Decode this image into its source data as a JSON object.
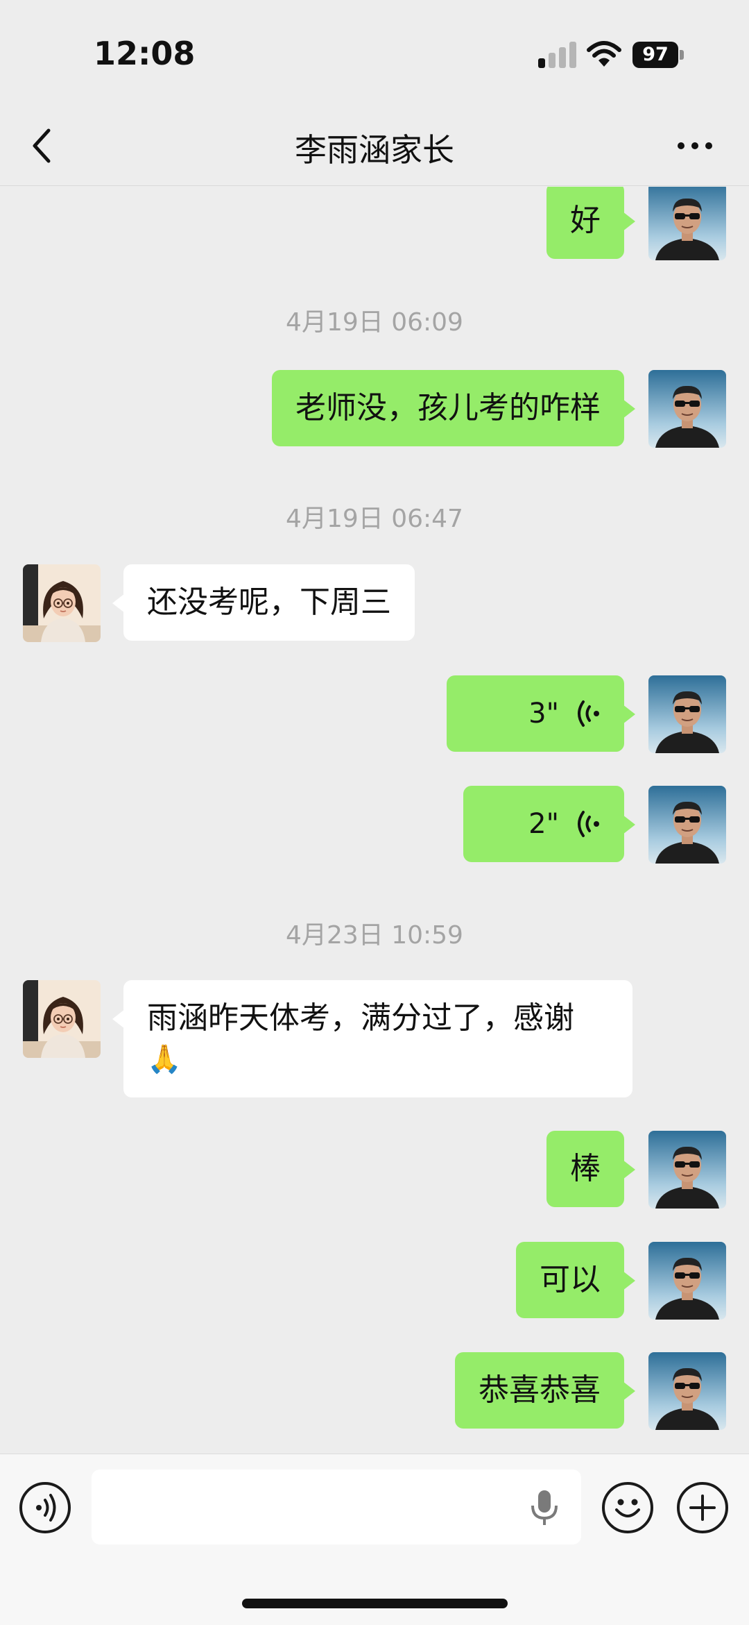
{
  "status_bar": {
    "time": "12:08",
    "battery": "97"
  },
  "nav": {
    "title": "李雨涵家长"
  },
  "messages": [
    {
      "side": "out",
      "text": "好"
    },
    {
      "timestamp": "4月19日 06:09"
    },
    {
      "side": "out",
      "text": "老师没，孩儿考的咋样"
    },
    {
      "timestamp": "4月19日 06:47"
    },
    {
      "side": "in",
      "text": "还没考呢，下周三"
    },
    {
      "side": "out",
      "voice": "3\""
    },
    {
      "side": "out",
      "voice": "2\""
    },
    {
      "timestamp": "4月23日 10:59"
    },
    {
      "side": "in",
      "text": "雨涵昨天体考，满分过了，感谢",
      "emoji": "🙏"
    },
    {
      "side": "out",
      "text": "棒"
    },
    {
      "side": "out",
      "text": "可以"
    },
    {
      "side": "out",
      "text": "恭喜恭喜"
    }
  ],
  "input_bar": {
    "text": ""
  },
  "colors": {
    "bubble_out": "#95EC69",
    "bubble_in": "#FFFFFF",
    "background": "#EDEDED"
  },
  "icons": [
    "back-icon",
    "more-icon",
    "voice-wave-icon",
    "voice-mode-icon",
    "microphone-icon",
    "emoji-icon",
    "plus-icon"
  ]
}
